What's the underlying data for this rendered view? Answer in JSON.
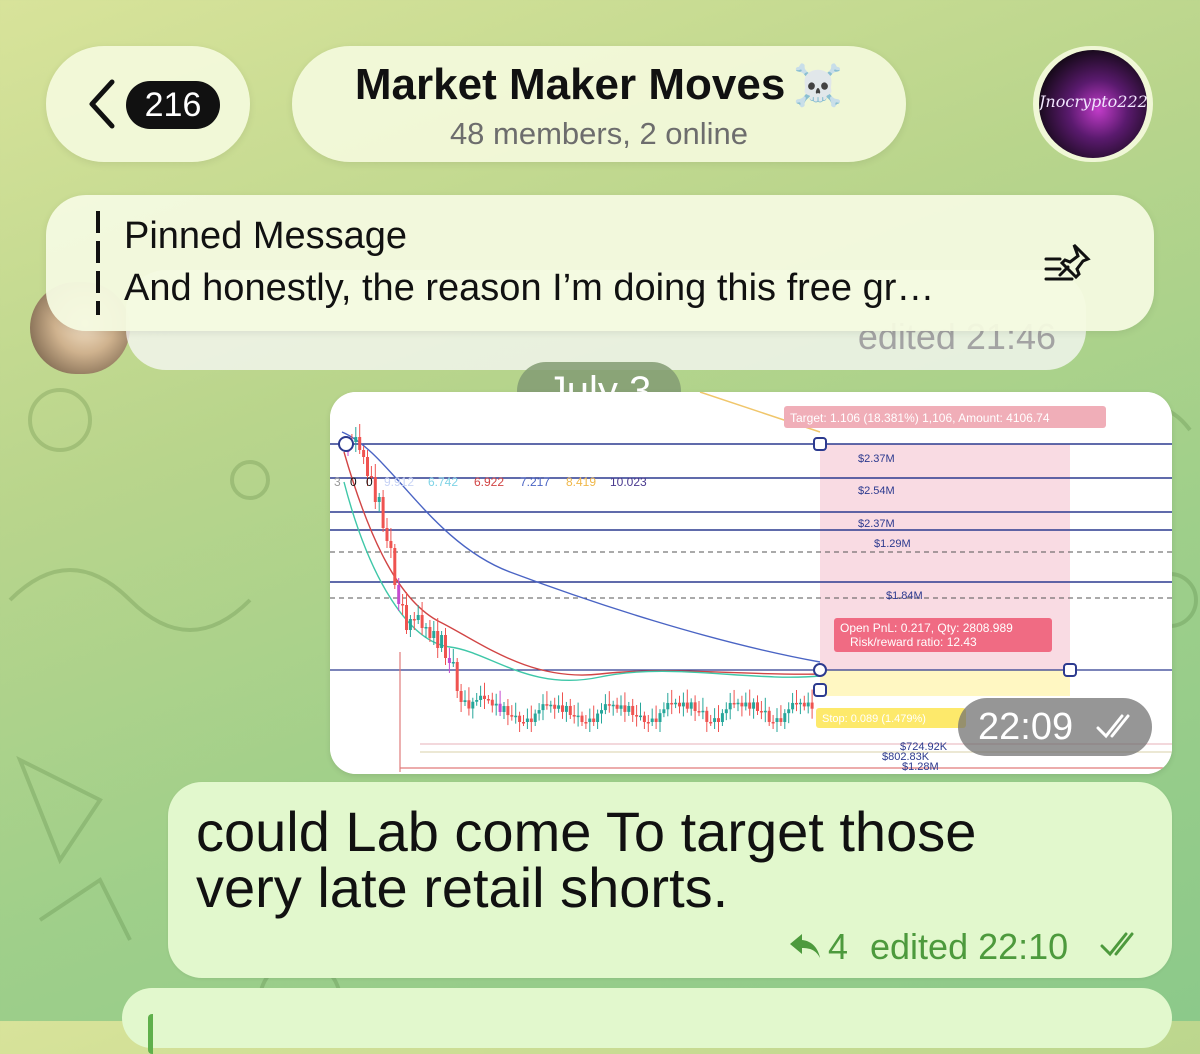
{
  "header": {
    "back_count": "216",
    "title": "Market Maker Moves",
    "title_emoji": "☠️",
    "subtitle": "48 members, 2 online",
    "avatar_text": "Jnocrypto222"
  },
  "pinned": {
    "title": "Pinned Message",
    "text": "And honestly, the reason I’m doing this free gr…"
  },
  "prev_message": {
    "edited": "edited 21:46"
  },
  "date_separator": "July 3",
  "chart_message": {
    "time": "22:09",
    "chart_data": {
      "type": "candlestick",
      "target_label": "Target: 1.106 (18.381%) 1,106, Amount: 4106.74",
      "open_pnl_line1": "Open PnL: 0.217, Qty: 2808.989",
      "open_pnl_line2": "Risk/reward ratio: 12.43",
      "stop_label": "Stop: 0.089 (1.479%)",
      "indicator_values": [
        "3",
        "0",
        "0",
        "9.912",
        "6.742",
        "6.922",
        "7.217",
        "8.419",
        "10.023"
      ],
      "level_labels": [
        "$2.37M",
        "$2.54M",
        "$2.37M",
        "$1.29M",
        "$1.84M"
      ],
      "bottom_labels": [
        "$724.92K",
        "$802.83K",
        "$1.28M"
      ]
    }
  },
  "text_message": {
    "text": "could Lab come To target those very late retail shorts.",
    "reply_count": "4",
    "edited": "edited 22:10"
  },
  "colors": {
    "bubble_out": "#e2f8cd",
    "accent_green": "#4d9a3d",
    "tp_zone": "#f9dbe3",
    "stop_zone": "#fff3a8"
  }
}
